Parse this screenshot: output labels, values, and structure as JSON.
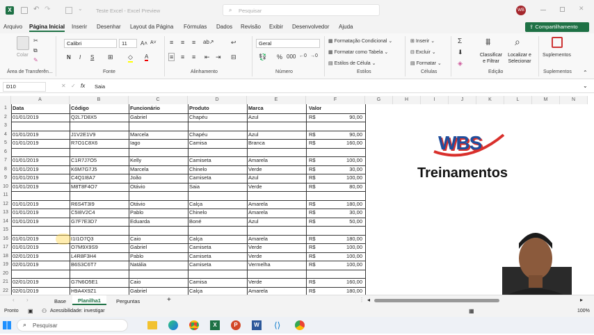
{
  "titlebar": {
    "file_title": "Teste Excel - Excel Preview",
    "search_placeholder": "Pesquisar",
    "avatar_initials": "WB"
  },
  "menu": {
    "tabs": [
      "Arquivo",
      "Página Inicial",
      "Inserir",
      "Desenhar",
      "Layout da Página",
      "Fórmulas",
      "Dados",
      "Revisão",
      "Exibir",
      "Desenvolvedor",
      "Ajuda"
    ],
    "share_label": "Compartilhamento"
  },
  "ribbon": {
    "clipboard": {
      "paste": "Colar",
      "group": "Área de Transferên..."
    },
    "font": {
      "name": "Calibri",
      "size": "11",
      "group": "Fonte"
    },
    "alignment": {
      "group": "Alinhamento"
    },
    "number": {
      "format": "Geral",
      "group": "Número"
    },
    "styles": {
      "cond": "Formatação Condicional",
      "table": "Formatar como Tabela",
      "cell": "Estilos de Célula",
      "group": "Estilos"
    },
    "cells": {
      "insert": "Inserir",
      "delete": "Excluir",
      "format": "Formatar",
      "group": "Células"
    },
    "editing": {
      "sort": "Classificar e Filtrar",
      "find": "Localizar e Selecionar",
      "group": "Edição"
    },
    "addins": {
      "label": "Suplementos",
      "group": "Suplementos"
    }
  },
  "formula_bar": {
    "name_box": "D10",
    "fx": "fx",
    "content": "Saia"
  },
  "columns": [
    "A",
    "B",
    "C",
    "D",
    "E",
    "F",
    "G",
    "H",
    "I",
    "J",
    "K",
    "L",
    "M",
    "N"
  ],
  "rows": [
    {
      "n": "1",
      "a": "Data",
      "b": "Código",
      "c": "Funcionário",
      "d": "Produto",
      "e": "Marca",
      "f1": "Valor",
      "f2": ""
    },
    {
      "n": "2",
      "a": "01/01/2019",
      "b": "Q2L7D8X5",
      "c": "Gabriel",
      "d": "Chapéu",
      "e": "Azul",
      "f1": "R$",
      "f2": "90,00"
    },
    {
      "n": "3",
      "a": "",
      "b": "",
      "c": "",
      "d": "",
      "e": "",
      "f1": "",
      "f2": ""
    },
    {
      "n": "4",
      "a": "01/01/2019",
      "b": "J1V2E1V9",
      "c": "Marcela",
      "d": "Chapéu",
      "e": "Azul",
      "f1": "R$",
      "f2": "90,00"
    },
    {
      "n": "5",
      "a": "01/01/2019",
      "b": "R7O1C8X6",
      "c": "Iago",
      "d": "Camisa",
      "e": "Branca",
      "f1": "R$",
      "f2": "160,00"
    },
    {
      "n": "6",
      "a": "",
      "b": "",
      "c": "",
      "d": "",
      "e": "",
      "f1": "",
      "f2": ""
    },
    {
      "n": "7",
      "a": "01/01/2019",
      "b": "C1R7J7O5",
      "c": "Kelly",
      "d": "Camiseta",
      "e": "Amarela",
      "f1": "R$",
      "f2": "100,00"
    },
    {
      "n": "8",
      "a": "01/01/2019",
      "b": "K6M7G7J5",
      "c": "Marcela",
      "d": "Chinelo",
      "e": "Verde",
      "f1": "R$",
      "f2": "30,00"
    },
    {
      "n": "9",
      "a": "01/01/2019",
      "b": "C4Q1I8A7",
      "c": "João",
      "d": "Camiseta",
      "e": "Azul",
      "f1": "R$",
      "f2": "100,00"
    },
    {
      "n": "10",
      "a": "01/01/2019",
      "b": "M8T8F4O7",
      "c": "Otávio",
      "d": "Saia",
      "e": "Verde",
      "f1": "R$",
      "f2": "80,00"
    },
    {
      "n": "11",
      "a": "",
      "b": "",
      "c": "",
      "d": "",
      "e": "",
      "f1": "",
      "f2": ""
    },
    {
      "n": "12",
      "a": "01/01/2019",
      "b": "R6S4T3I9",
      "c": "Otávio",
      "d": "Calça",
      "e": "Amarela",
      "f1": "R$",
      "f2": "180,00"
    },
    {
      "n": "13",
      "a": "01/01/2019",
      "b": "C5I8V2C4",
      "c": "Pablo",
      "d": "Chinelo",
      "e": "Amarela",
      "f1": "R$",
      "f2": "30,00"
    },
    {
      "n": "14",
      "a": "01/01/2019",
      "b": "G7F7E3D7",
      "c": "Eduarda",
      "d": "Boné",
      "e": "Azul",
      "f1": "R$",
      "f2": "50,00"
    },
    {
      "n": "15",
      "a": "",
      "b": "",
      "c": "",
      "d": "",
      "e": "",
      "f1": "",
      "f2": ""
    },
    {
      "n": "16",
      "a": "01/01/2019",
      "b": "I1I1O7Q3",
      "c": "Caio",
      "d": "Calça",
      "e": "Amarela",
      "f1": "R$",
      "f2": "180,00"
    },
    {
      "n": "17",
      "a": "01/01/2019",
      "b": "O7M9X9S9",
      "c": "Gabriel",
      "d": "Camiseta",
      "e": "Verde",
      "f1": "R$",
      "f2": "100,00"
    },
    {
      "n": "18",
      "a": "02/01/2019",
      "b": "L4R8F3H4",
      "c": "Pablo",
      "d": "Camiseta",
      "e": "Verde",
      "f1": "R$",
      "f2": "100,00"
    },
    {
      "n": "19",
      "a": "02/01/2019",
      "b": "B6S3C6T7",
      "c": "Natália",
      "d": "Camiseta",
      "e": "Vermelha",
      "f1": "R$",
      "f2": "100,00"
    },
    {
      "n": "20",
      "a": "",
      "b": "",
      "c": "",
      "d": "",
      "e": "",
      "f1": "",
      "f2": ""
    },
    {
      "n": "21",
      "a": "02/01/2019",
      "b": "G7N6O5E1",
      "c": "Caio",
      "d": "Camisa",
      "e": "Verde",
      "f1": "R$",
      "f2": "160,00"
    },
    {
      "n": "22",
      "a": "02/01/2019",
      "b": "H9A4X9Z1",
      "c": "Gabriel",
      "d": "Calça",
      "e": "Amarela",
      "f1": "R$",
      "f2": "180,00"
    }
  ],
  "logo": {
    "letters": "WBS",
    "text": "Treinamentos"
  },
  "sheets": {
    "tabs": [
      "Base",
      "Planilha1",
      "Perguntas"
    ],
    "active": "Planilha1"
  },
  "status": {
    "ready": "Pronto",
    "accessibility": "Acessibilidade: investigar",
    "zoom": "100%"
  },
  "taskbar": {
    "search": "Pesquisar"
  },
  "colors": {
    "excel_green": "#1e7145",
    "logo_red": "#d9302c",
    "logo_blue": "#1f4e9c"
  }
}
